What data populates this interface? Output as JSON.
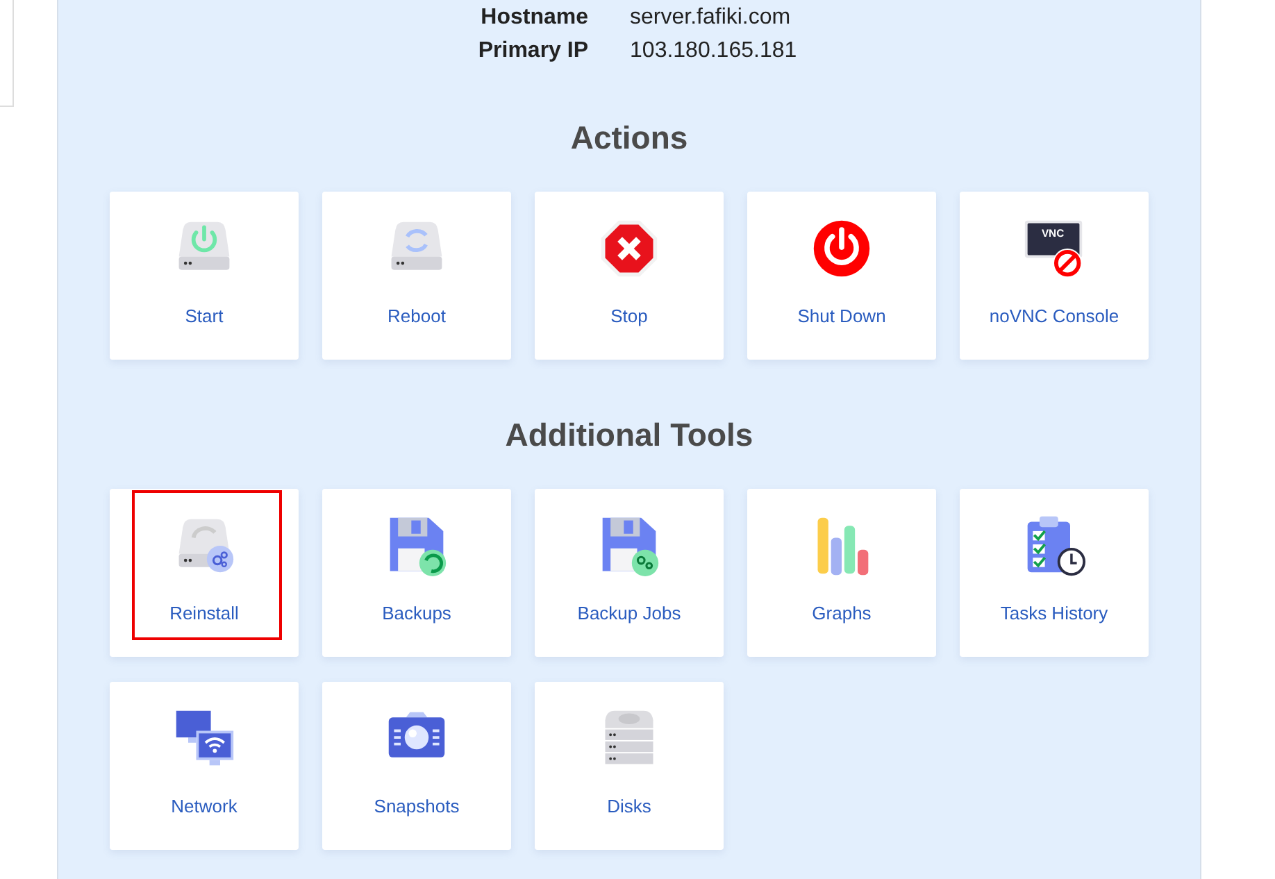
{
  "server_info": [
    {
      "label": "Hostname",
      "value": "server.fafiki.com"
    },
    {
      "label": "Primary IP",
      "value": "103.180.165.181"
    }
  ],
  "sections": [
    {
      "title": "Actions",
      "tiles": [
        {
          "label": "Start",
          "kind": "start",
          "highlighted": false
        },
        {
          "label": "Reboot",
          "kind": "reboot",
          "highlighted": false
        },
        {
          "label": "Stop",
          "kind": "stop",
          "highlighted": false
        },
        {
          "label": "Shut Down",
          "kind": "shutdown",
          "highlighted": false
        },
        {
          "label": "noVNC Console",
          "kind": "vnc",
          "icon_text": "VNC",
          "highlighted": false
        }
      ]
    },
    {
      "title": "Additional Tools",
      "tiles": [
        {
          "label": "Reinstall",
          "kind": "reinstall",
          "highlighted": true
        },
        {
          "label": "Backups",
          "kind": "backups",
          "highlighted": false
        },
        {
          "label": "Backup Jobs",
          "kind": "backup-jobs",
          "highlighted": false
        },
        {
          "label": "Graphs",
          "kind": "graphs",
          "highlighted": false
        },
        {
          "label": "Tasks History",
          "kind": "tasks",
          "highlighted": false
        },
        {
          "label": "Network",
          "kind": "network",
          "highlighted": false
        },
        {
          "label": "Snapshots",
          "kind": "snapshots",
          "highlighted": false
        },
        {
          "label": "Disks",
          "kind": "disks",
          "highlighted": false
        }
      ]
    }
  ]
}
